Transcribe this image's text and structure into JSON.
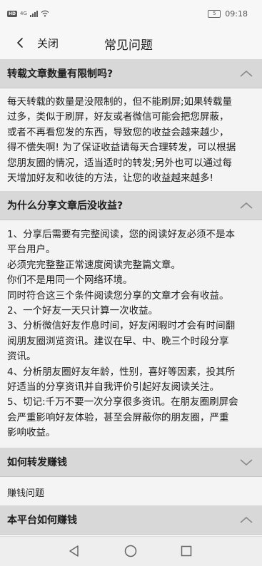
{
  "status_bar": {
    "hd_badge": "HD",
    "network": "4G",
    "battery": "5",
    "time": "09:18"
  },
  "nav": {
    "close_label": "关闭",
    "title": "常见问题"
  },
  "faq": [
    {
      "question": "转载文章数量有限制吗?",
      "expanded": true,
      "answer_lines": [
        "每天转载的数量是没限制的，但不能刷屏;如果转载量",
        "过多，类似于刷屏，好友或者微信可能会把您屏蔽，",
        "或者不再看您发的东西，导致您的收益会越来越少，",
        "得不偿失啊! 为了保证收益请每天合理转发，可以根据",
        "您朋友圈的情况，适当适时的转发;另外也可以通过每",
        "天增加好友和收徒的方法，让您的收益越来越多!"
      ]
    },
    {
      "question": "为什么分享文章后没收益?",
      "expanded": true,
      "answer_lines": [
        "1、分享后需要有完整阅读，您的阅读好友必须不是本",
        "平台用户。",
        "必须完完整整正常速度阅读完整篇文章。",
        "你们不是用同一个网络环境。",
        "同时符合这三个条件阅读您分享的文章才会有收益。",
        "2、一个好友一天只计算一次收益。",
        "3、分析微信好友作息时间，好友闲暇时才会有时间翻",
        "阅朋友圈浏览资讯。建议在早、中、晚三个时段分享",
        "资讯。",
        "4、分析朋友圈好友年龄，性别，喜好等因素，投其所",
        "好适当的分享资讯并自我评价引起好友阅读关注。",
        "5、切记:千万不要一次分享很多资讯。在朋友圈刷屏会",
        "会严重影响好友体验，甚至会屏蔽你的朋友圈，严重",
        "影响收益。"
      ]
    },
    {
      "question": "如何转发赚钱",
      "expanded": false,
      "answer_lines": [
        "赚钱问题"
      ]
    },
    {
      "question": "本平台如何赚钱",
      "expanded": true,
      "answer_lines": []
    }
  ]
}
